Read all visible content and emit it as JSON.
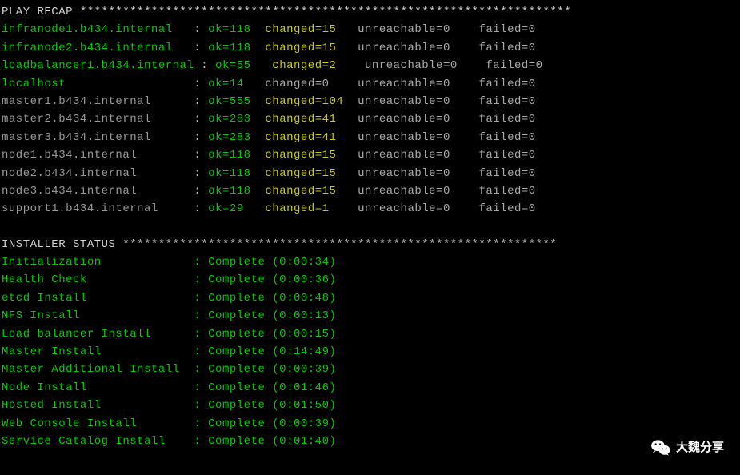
{
  "recap": {
    "title": "PLAY RECAP",
    "stars": "*********************************************************************",
    "hosts": [
      {
        "name": "infranode1.b434.internal",
        "nameColor": "green",
        "ok": 118,
        "changed": 15,
        "changedStyle": "yellow",
        "unreachable": 0,
        "failed": 0,
        "pad": 2
      },
      {
        "name": "infranode2.b434.internal",
        "nameColor": "green",
        "ok": 118,
        "changed": 15,
        "changedStyle": "yellow",
        "unreachable": 0,
        "failed": 0,
        "pad": 2
      },
      {
        "name": "loadbalancer1.b434.internal",
        "nameColor": "green",
        "ok": 55,
        "changed": 2,
        "changedStyle": "yellow",
        "unreachable": 0,
        "failed": 0,
        "pad": 0,
        "okCol": true
      },
      {
        "name": "localhost",
        "nameColor": "green",
        "ok": 14,
        "changed": 0,
        "changedStyle": "gray",
        "unreachable": 0,
        "failed": 0,
        "pad": 17
      },
      {
        "name": "master1.b434.internal",
        "nameColor": "gray",
        "ok": 555,
        "changed": 104,
        "changedStyle": "yellow",
        "unreachable": 0,
        "failed": 0,
        "pad": 5
      },
      {
        "name": "master2.b434.internal",
        "nameColor": "gray",
        "ok": 283,
        "changed": 41,
        "changedStyle": "yellow",
        "unreachable": 0,
        "failed": 0,
        "pad": 5
      },
      {
        "name": "master3.b434.internal",
        "nameColor": "gray",
        "ok": 283,
        "changed": 41,
        "changedStyle": "yellow",
        "unreachable": 0,
        "failed": 0,
        "pad": 5
      },
      {
        "name": "node1.b434.internal",
        "nameColor": "gray",
        "ok": 118,
        "changed": 15,
        "changedStyle": "yellow",
        "unreachable": 0,
        "failed": 0,
        "pad": 7
      },
      {
        "name": "node2.b434.internal",
        "nameColor": "gray",
        "ok": 118,
        "changed": 15,
        "changedStyle": "yellow",
        "unreachable": 0,
        "failed": 0,
        "pad": 7
      },
      {
        "name": "node3.b434.internal",
        "nameColor": "gray",
        "ok": 118,
        "changed": 15,
        "changedStyle": "yellow",
        "unreachable": 0,
        "failed": 0,
        "pad": 7
      },
      {
        "name": "support1.b434.internal",
        "nameColor": "gray",
        "ok": 29,
        "changed": 1,
        "changedStyle": "yellow",
        "unreachable": 0,
        "failed": 0,
        "pad": 4
      }
    ]
  },
  "installer": {
    "title": "INSTALLER STATUS",
    "stars": "*************************************************************",
    "steps": [
      {
        "name": "Initialization",
        "status": "Complete",
        "time": "0:00:34"
      },
      {
        "name": "Health Check",
        "status": "Complete",
        "time": "0:00:36"
      },
      {
        "name": "etcd Install",
        "status": "Complete",
        "time": "0:00:48"
      },
      {
        "name": "NFS Install",
        "status": "Complete",
        "time": "0:00:13"
      },
      {
        "name": "Load balancer Install",
        "status": "Complete",
        "time": "0:00:15"
      },
      {
        "name": "Master Install",
        "status": "Complete",
        "time": "0:14:49"
      },
      {
        "name": "Master Additional Install",
        "status": "Complete",
        "time": "0:00:39"
      },
      {
        "name": "Node Install",
        "status": "Complete",
        "time": "0:01:46"
      },
      {
        "name": "Hosted Install",
        "status": "Complete",
        "time": "0:01:50"
      },
      {
        "name": "Web Console Install",
        "status": "Complete",
        "time": "0:00:39"
      },
      {
        "name": "Service Catalog Install",
        "status": "Complete",
        "time": "0:01:40"
      }
    ]
  },
  "watermark": {
    "text": "大魏分享"
  }
}
